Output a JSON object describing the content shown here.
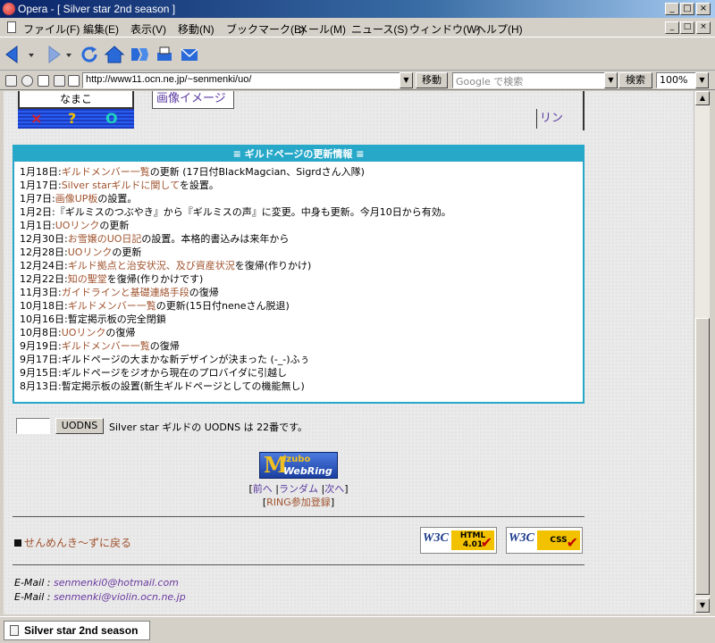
{
  "window": {
    "title": "Opera - [ Silver star 2nd season ]",
    "min": "_",
    "max": "□",
    "close": "×"
  },
  "menu": {
    "items": [
      "ファイル(F)",
      "編集(E)",
      "表示(V)",
      "移動(N)",
      "ブックマーク(B)",
      "メール(M)",
      "ニュース(S)",
      "ウィンドウ(W)",
      "ヘルプ(H)"
    ]
  },
  "address": {
    "url": "http://www11.ocn.ne.jp/~senmenki/uo/",
    "go_label": "移動",
    "search_placeholder": "Google で検索",
    "search_label": "検索",
    "zoom": "100%"
  },
  "page": {
    "top": {
      "namako": "なまこ",
      "symbols": [
        "×",
        "?",
        "O"
      ],
      "image_link": "画像イメージ",
      "right_link": "リン"
    },
    "updates": {
      "header": "≡ ギルドページの更新情報 ≡",
      "items": [
        {
          "date": "1月18日:",
          "link": "ギルドメンバー一覧",
          "rest": "の更新 (17日付BlackMagcian、Sigrdさん入隊)"
        },
        {
          "date": "1月17日:",
          "link": "Silver starギルドに関して",
          "rest": "を設置。"
        },
        {
          "date": "1月7日:",
          "link": "画像UP板",
          "rest": "の設置。"
        },
        {
          "date": "1月2日:",
          "link": "",
          "rest": "『ギルミスのつぶやき』から『ギルミスの声』に変更。中身も更新。今月10日から有効。"
        },
        {
          "date": "1月1日:",
          "link": "UOリンク",
          "rest": "の更新"
        },
        {
          "date": "12月30日:",
          "link": "お雪嬢のUO日記",
          "rest": "の設置。本格的書込みは来年から"
        },
        {
          "date": "12月28日:",
          "link": "UOリンク",
          "rest": "の更新"
        },
        {
          "date": "12月24日:",
          "link": "ギルド拠点と治安状況、及び資産状況",
          "rest": "を復帰(作りかけ)"
        },
        {
          "date": "12月22日:",
          "link": "知の聖堂",
          "rest": "を復帰(作りかけです)"
        },
        {
          "date": "11月3日:",
          "link": "ガイドラインと基礎連絡手段",
          "rest": "の復帰"
        },
        {
          "date": "10月18日:",
          "link": "ギルドメンバー一覧",
          "rest": "の更新(15日付neneさん脱退)"
        },
        {
          "date": "10月16日:",
          "link": "",
          "rest": "暫定掲示板の完全閉鎖"
        },
        {
          "date": "10月8日:",
          "link": "UOリンク",
          "rest": "の復帰"
        },
        {
          "date": "9月19日:",
          "link": "ギルドメンバー一覧",
          "rest": "の復帰"
        },
        {
          "date": "9月17日:",
          "link": "",
          "rest": "ギルドページの大まかな新デザインが決まった (-_-)ふぅ"
        },
        {
          "date": "9月15日:",
          "link": "",
          "rest": "ギルドページをジオから現在のプロバイダに引越し"
        },
        {
          "date": "8月13日:",
          "link": "",
          "rest": "暫定掲示板の設置(新生ギルドページとしての機能無し)"
        }
      ]
    },
    "dns": {
      "button": "UODNS",
      "text": "Silver star ギルドの UODNS は 22番です。"
    },
    "webring": {
      "logo_m": "M",
      "logo_top": "izubo",
      "logo_bottom": "WebRing",
      "nav_open": "[",
      "prev": "前へ",
      "random": "ランダム",
      "next": "次へ",
      "nav_close": "]",
      "sep": "|",
      "join_open": "[",
      "join": "RING参加登録",
      "join_close": "]"
    },
    "back_link": "せんめんき～ずに戻る",
    "badges": [
      {
        "w3c": "W3C",
        "label": "HTML 4.01",
        "check": "✔"
      },
      {
        "w3c": "W3C",
        "label": "CSS",
        "check": "✔"
      }
    ],
    "emails": [
      {
        "label": "E-Mail :",
        "addr": "senmenki0@hotmail.com"
      },
      {
        "label": "E-Mail :",
        "addr": "senmenki@violin.ocn.ne.jp"
      }
    ]
  },
  "status": {
    "tab_title": "Silver star 2nd season"
  }
}
